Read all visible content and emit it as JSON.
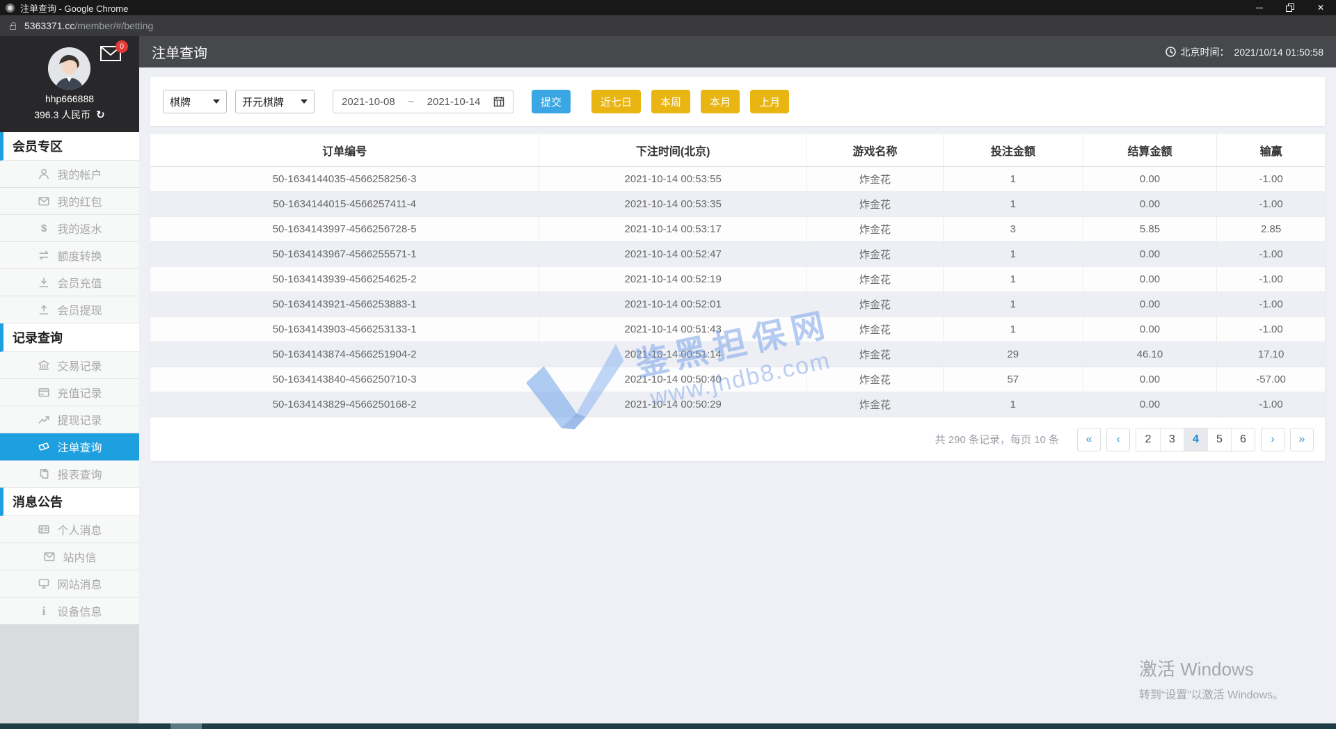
{
  "browser": {
    "title": "注单查询 - Google Chrome",
    "url_domain": "5363371.cc",
    "url_path": "/member/#/betting"
  },
  "header": {
    "title": "注单查询",
    "time_label": "北京时间：",
    "time_value": "2021/10/14 01:50:58"
  },
  "user": {
    "name": "hhp666888",
    "balance": "396.3 人民币",
    "mail_badge": "0"
  },
  "sidebar": {
    "sections": [
      {
        "title": "会员专区",
        "items": [
          {
            "key": "account",
            "icon": "user-icon",
            "label": "我的帐户"
          },
          {
            "key": "red-packet",
            "icon": "red-packet-icon",
            "label": "我的红包"
          },
          {
            "key": "rebate",
            "icon": "dollar-icon",
            "label": "我的返水"
          },
          {
            "key": "quota-transfer",
            "icon": "transfer-icon",
            "label": "额度转换"
          },
          {
            "key": "deposit",
            "icon": "deposit-icon",
            "label": "会员充值"
          },
          {
            "key": "withdraw",
            "icon": "withdraw-icon",
            "label": "会员提现"
          }
        ]
      },
      {
        "title": "记录查询",
        "items": [
          {
            "key": "transactions",
            "icon": "bank-icon",
            "label": "交易记录"
          },
          {
            "key": "deposit-records",
            "icon": "card-icon",
            "label": "充值记录"
          },
          {
            "key": "withdraw-records",
            "icon": "chart-line-icon",
            "label": "提现记录"
          },
          {
            "key": "betting",
            "icon": "ticket-icon",
            "label": "注单查询",
            "active": true
          },
          {
            "key": "reports",
            "icon": "report-icon",
            "label": "报表查询"
          }
        ]
      },
      {
        "title": "消息公告",
        "items": [
          {
            "key": "personal-messages",
            "icon": "id-card-icon",
            "label": "个人消息"
          },
          {
            "key": "site-mail",
            "icon": "mail-icon",
            "label": "站内信"
          },
          {
            "key": "site-messages",
            "icon": "monitor-icon",
            "label": "网站消息"
          },
          {
            "key": "device-info",
            "icon": "info-icon",
            "label": "设备信息"
          }
        ]
      }
    ]
  },
  "filters": {
    "category": "棋牌",
    "provider": "开元棋牌",
    "date_from": "2021-10-08",
    "date_separator": "~",
    "date_to": "2021-10-14",
    "submit_label": "提交",
    "quick_buttons": [
      "近七日",
      "本周",
      "本月",
      "上月"
    ]
  },
  "table": {
    "columns": [
      "订单编号",
      "下注时间(北京)",
      "游戏名称",
      "投注金额",
      "结算金额",
      "输赢"
    ],
    "rows": [
      [
        "50-1634144035-4566258256-3",
        "2021-10-14 00:53:55",
        "炸金花",
        "1",
        "0.00",
        "-1.00"
      ],
      [
        "50-1634144015-4566257411-4",
        "2021-10-14 00:53:35",
        "炸金花",
        "1",
        "0.00",
        "-1.00"
      ],
      [
        "50-1634143997-4566256728-5",
        "2021-10-14 00:53:17",
        "炸金花",
        "3",
        "5.85",
        "2.85"
      ],
      [
        "50-1634143967-4566255571-1",
        "2021-10-14 00:52:47",
        "炸金花",
        "1",
        "0.00",
        "-1.00"
      ],
      [
        "50-1634143939-4566254625-2",
        "2021-10-14 00:52:19",
        "炸金花",
        "1",
        "0.00",
        "-1.00"
      ],
      [
        "50-1634143921-4566253883-1",
        "2021-10-14 00:52:01",
        "炸金花",
        "1",
        "0.00",
        "-1.00"
      ],
      [
        "50-1634143903-4566253133-1",
        "2021-10-14 00:51:43",
        "炸金花",
        "1",
        "0.00",
        "-1.00"
      ],
      [
        "50-1634143874-4566251904-2",
        "2021-10-14 00:51:14",
        "炸金花",
        "29",
        "46.10",
        "17.10"
      ],
      [
        "50-1634143840-4566250710-3",
        "2021-10-14 00:50:40",
        "炸金花",
        "57",
        "0.00",
        "-57.00"
      ],
      [
        "50-1634143829-4566250168-2",
        "2021-10-14 00:50:29",
        "炸金花",
        "1",
        "0.00",
        "-1.00"
      ]
    ]
  },
  "pagination": {
    "summary": "共 290 条记录，每页 10 条",
    "arrows_left": [
      "«",
      "‹"
    ],
    "pages": [
      "2",
      "3",
      "4",
      "5",
      "6"
    ],
    "active_page": "4",
    "arrows_right": [
      "›",
      "»"
    ]
  },
  "watermark": {
    "line1": "鉴黑担保网",
    "line2": "www.jhdb8.com"
  },
  "windows_activation": {
    "line1": "激活 Windows",
    "line2": "转到“设置”以激活 Windows。"
  },
  "colors": {
    "accent_blue": "#1e9fe0",
    "submit_button": "#3aa7e4",
    "quick_button": "#e8b512",
    "badge_red": "#e53935",
    "header_bar": "#46484b"
  }
}
